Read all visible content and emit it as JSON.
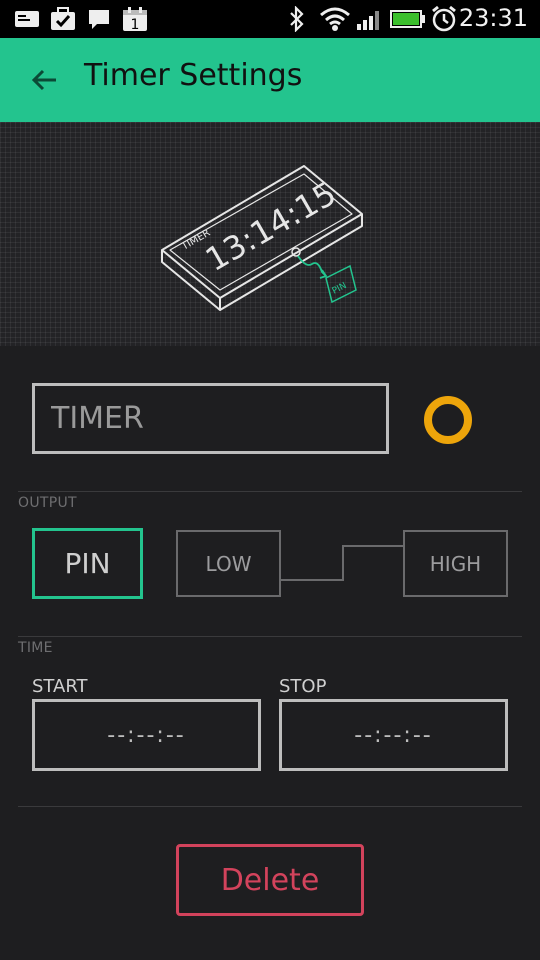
{
  "status_bar": {
    "time": "23:31",
    "icons": [
      "mail-icon",
      "briefcase-check-icon",
      "message-icon",
      "calendar-icon",
      "bluetooth-icon",
      "wifi-icon",
      "signal-icon",
      "battery-icon",
      "alarm-icon"
    ],
    "calendar_day": "1"
  },
  "app_bar": {
    "title": "Timer Settings",
    "back_icon": "arrow-left-icon",
    "color": "#23c48e"
  },
  "illustration": {
    "device_label": "TIMER",
    "device_time": "13:14:15",
    "pin_label": "PIN"
  },
  "name_field": {
    "placeholder": "TIMER",
    "value": ""
  },
  "color_picker": {
    "color": "#eda50b"
  },
  "output": {
    "section_label": "OUTPUT",
    "pin_button": "PIN",
    "low_label": "LOW",
    "high_label": "HIGH"
  },
  "time": {
    "section_label": "TIME",
    "start_label": "START",
    "start_value": "--:--:--",
    "stop_label": "STOP",
    "stop_value": "--:--:--"
  },
  "actions": {
    "delete_label": "Delete",
    "delete_color": "#d3435c"
  }
}
